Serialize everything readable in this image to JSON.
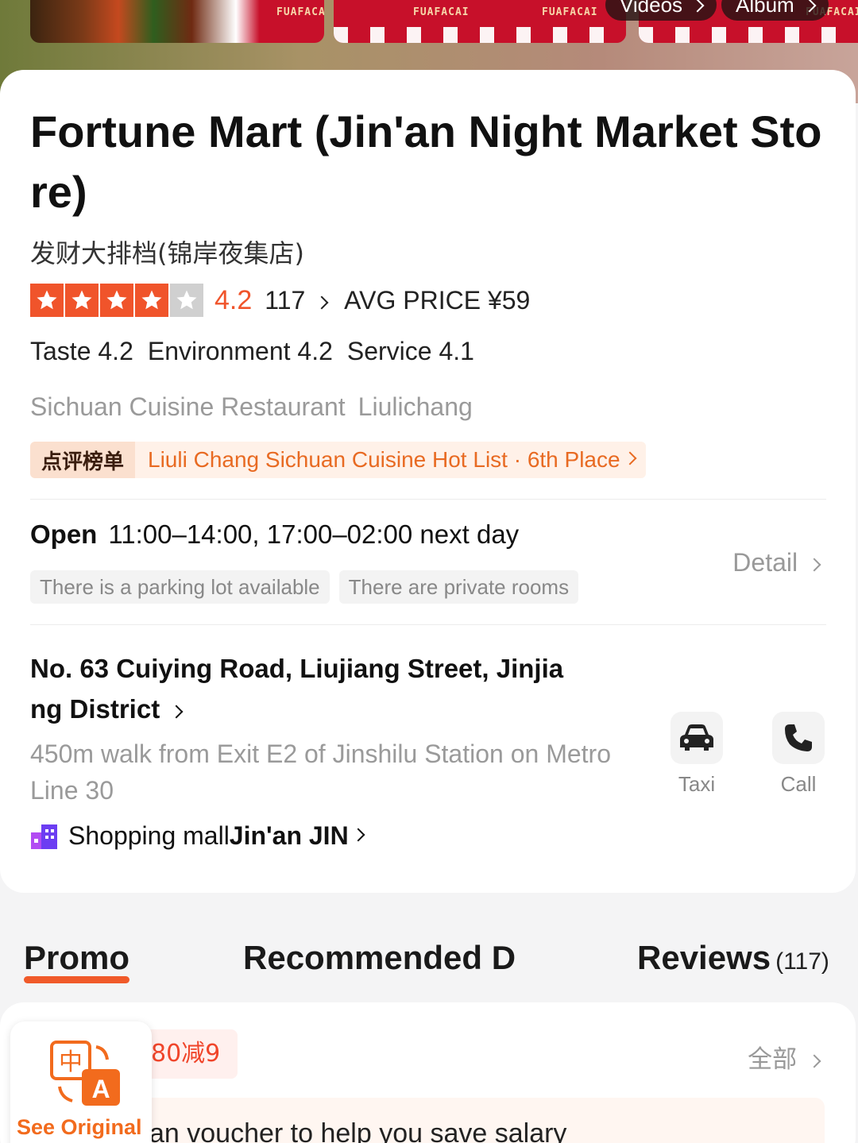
{
  "media": {
    "brand_text": "FUAFACAI",
    "videos_label": "Videos",
    "album_label": "Album"
  },
  "store": {
    "name": "Fortune Mart (Jin'an Night Market Store)",
    "name_cn": "发财大排档(锦岸夜集店)",
    "rating": "4.2",
    "rating_stars": 4,
    "review_count": "117",
    "avg_price": "AVG PRICE ¥59",
    "subscores": [
      "Taste 4.2",
      "Environment 4.2",
      "Service 4.1"
    ],
    "category": "Sichuan Cuisine Restaurant",
    "area": "Liulichang",
    "hotlist_tag": "点评榜单",
    "hotlist_text": "Liuli Chang Sichuan Cuisine Hot List · 6th Place",
    "open_label": "Open",
    "hours": "11:00–14:00, 17:00–02:00 next day",
    "facilities": [
      "There is a parking lot available",
      "There are private rooms"
    ],
    "detail_label": "Detail",
    "address": "No. 63 Cuiying Road, Liujiang Street, Jinjiang District",
    "transit": "450m walk from Exit E2 of Jinshilu Station on Metro Line 30",
    "mall_prefix": "Shopping mall",
    "mall_name": "Jin'an JIN"
  },
  "actions": {
    "taxi_label": "Taxi",
    "call_label": "Call"
  },
  "tabs": {
    "promo": "Promo",
    "dishes": "Recommended D",
    "reviews": "Reviews",
    "reviews_count": "(117)"
  },
  "promo": {
    "chip": "80减9",
    "all_label": "全部",
    "voucher_text": "an voucher to help you save salary"
  },
  "translate": {
    "label": "See Original"
  },
  "colors": {
    "accent": "#f0542b",
    "hotlist_text": "#e86a22",
    "translate_label": "#f26b1d"
  }
}
